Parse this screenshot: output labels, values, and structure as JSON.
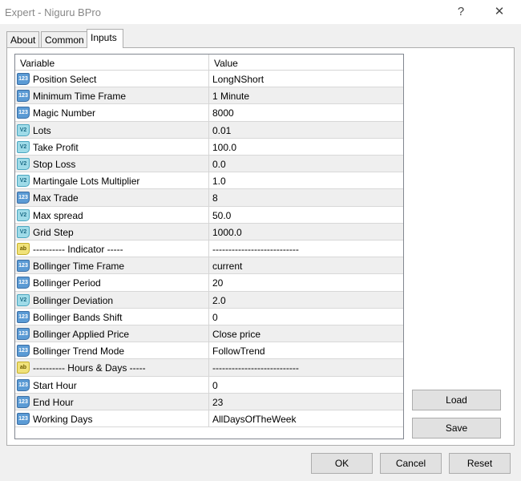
{
  "window": {
    "title": "Expert - Niguru BPro",
    "help": "?",
    "close": "✕"
  },
  "tabs": [
    {
      "label": "About"
    },
    {
      "label": "Common"
    },
    {
      "label": "Inputs"
    }
  ],
  "table": {
    "headers": {
      "variable": "Variable",
      "value": "Value"
    },
    "rows": [
      {
        "type": "123",
        "variable": "Position Select",
        "value": "LongNShort"
      },
      {
        "type": "123",
        "variable": "Minimum Time Frame",
        "value": "1 Minute"
      },
      {
        "type": "123",
        "variable": "Magic Number",
        "value": "8000"
      },
      {
        "type": "V2",
        "variable": "Lots",
        "value": "0.01"
      },
      {
        "type": "V2",
        "variable": "Take Profit",
        "value": "100.0"
      },
      {
        "type": "V2",
        "variable": "Stop Loss",
        "value": "0.0"
      },
      {
        "type": "V2",
        "variable": "Martingale Lots Multiplier",
        "value": "1.0"
      },
      {
        "type": "123",
        "variable": "Max Trade",
        "value": "8"
      },
      {
        "type": "V2",
        "variable": "Max spread",
        "value": "50.0"
      },
      {
        "type": "V2",
        "variable": "Grid Step",
        "value": "1000.0"
      },
      {
        "type": "ab",
        "variable": "---------- Indicator -----",
        "value": "---------------------------"
      },
      {
        "type": "123",
        "variable": "Bollinger Time Frame",
        "value": "current"
      },
      {
        "type": "123",
        "variable": "Bollinger Period",
        "value": "20"
      },
      {
        "type": "V2",
        "variable": "Bollinger Deviation",
        "value": "2.0"
      },
      {
        "type": "123",
        "variable": "Bollinger Bands Shift",
        "value": "0"
      },
      {
        "type": "123",
        "variable": "Bollinger Applied Price",
        "value": "Close price"
      },
      {
        "type": "123",
        "variable": "Bollinger Trend Mode",
        "value": "FollowTrend"
      },
      {
        "type": "ab",
        "variable": "---------- Hours & Days -----",
        "value": "---------------------------"
      },
      {
        "type": "123",
        "variable": "Start Hour",
        "value": "0"
      },
      {
        "type": "123",
        "variable": "End Hour",
        "value": "23"
      },
      {
        "type": "123",
        "variable": "Working Days",
        "value": "AllDaysOfTheWeek"
      }
    ]
  },
  "buttons": {
    "load": "Load",
    "save": "Save",
    "ok": "OK",
    "cancel": "Cancel",
    "reset": "Reset"
  }
}
